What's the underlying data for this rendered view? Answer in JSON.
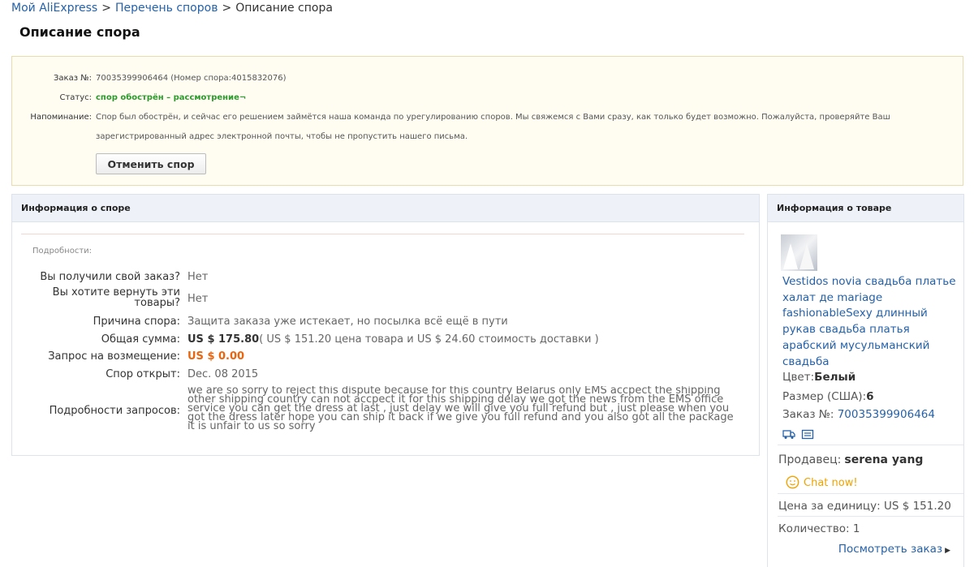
{
  "breadcrumb": {
    "items": [
      "Мой AliExpress",
      "Перечень споров",
      "Описание спора"
    ],
    "separator": ">"
  },
  "page_title": "Описание спора",
  "status_box": {
    "order_label": "Заказ №:",
    "order_value": "70035399906464 (Номер спора:4015832076)",
    "status_label": "Статус:",
    "status_value": "спор обострён – рассмотрение¬",
    "reminder_label": "Напоминание:",
    "reminder_text": "Спор был обострён, и сейчас его решением займётся наша команда по урегулированию споров. Мы свяжемся с Вами сразу, как только будет возможно. Пожалуйста, проверяйте Ваш зарегистрированный адрес электронной почты, чтобы не пропустить нашего письма.",
    "cancel_button": "Отменить спор"
  },
  "dispute": {
    "header": "Информация о споре",
    "details_caption": "Подробности:",
    "received_label": "Вы получили свой заказ?",
    "received_value": "Нет",
    "return_label_1": "Вы хотите вернуть эти",
    "return_label_2": "товары?",
    "return_value": "Нет",
    "reason_label": "Причина спора:",
    "reason_value": "Защита заказа уже истекает, но посылка всё ещё в пути",
    "total_label": "Общая сумма:",
    "total_amount": "US $ 175.80",
    "total_breakdown": "( US $ 151.20 цена товара и US $ 24.60 стоимость доставки )",
    "refund_label": "Запрос на возмещение:",
    "refund_value": "US $ 0.00",
    "opened_label": "Спор открыт:",
    "opened_value": "Dec. 08 2015",
    "request_label": "Подробности запросов:",
    "request_lines": [
      "we are so sorry to reject this dispute because for this country Belarus only EMS accpect the shipping",
      "other shipping country can not accpect it for this shipping delay we got the news from the EMS office",
      "service you can get the dress at last , just delay we will give you full refund but , just please when you",
      "got the dress later hope you can ship it back if we give you full refund and you also got all the package",
      "it is unfair to us so sorry"
    ]
  },
  "product": {
    "header": "Информация о товаре",
    "title": "Vestidos novia свадьба платье халат де mariage fashionableSexy длинный рукав свадьба платья арабский мусульманский свадьба",
    "color_label": "Цвет:",
    "color_value": "Белый",
    "size_label": "Размер (США):",
    "size_value": "6",
    "order_label": "Заказ №:",
    "order_value": "70035399906464",
    "seller_label": "Продавец:",
    "seller_name": "serena yang",
    "chat_label": "Chat now!",
    "unit_price_label": "Цена за единицу:",
    "unit_price_value": "US $ 151.20",
    "qty_label": "Количество:",
    "qty_value": "1",
    "view_order": "Посмотреть заказ",
    "icons": [
      "shipping-icon",
      "invoice-icon"
    ]
  },
  "colors": {
    "link": "#2561a9",
    "status_green": "#2b9c2b",
    "refund_orange": "#e8660f",
    "chat_yellow": "#f0a300",
    "status_box_bg": "#fffdf2"
  }
}
